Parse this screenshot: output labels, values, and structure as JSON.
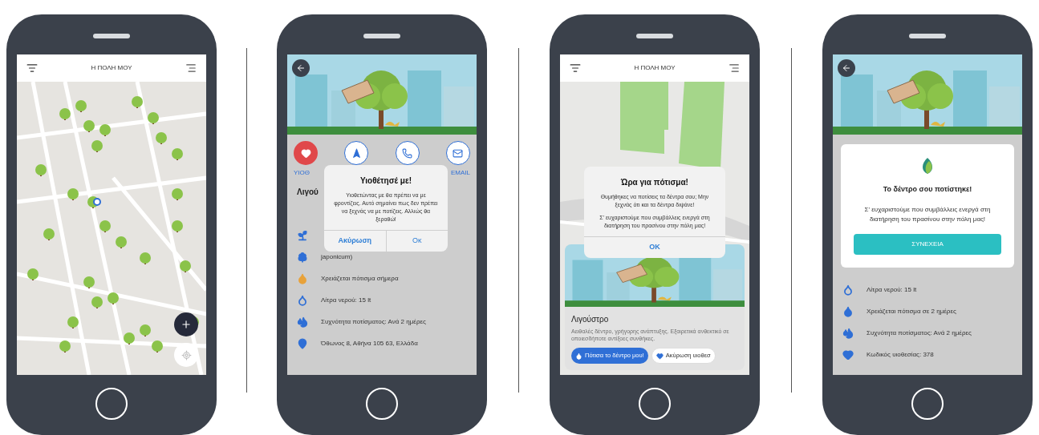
{
  "phones": [
    {
      "kind": "map",
      "header": {
        "title": "Η ΠΟΛΗ ΜΟΥ"
      }
    },
    {
      "kind": "detail",
      "actions": [
        {
          "kind": "heart",
          "label": "ΥΙΟΘ",
          "active": true
        },
        {
          "kind": "navigate",
          "active": false
        },
        {
          "kind": "phone",
          "active": false
        },
        {
          "kind": "mail",
          "label": "EMAIL",
          "active": false
        }
      ],
      "title": "Λιγού",
      "rows": [
        {
          "kind": "planter",
          "color": "#2f6fd6"
        },
        {
          "kind": "tree",
          "text": "japonicum)",
          "color": "#2f6fd6"
        },
        {
          "kind": "drop",
          "text": "Χρειάζεται πότισμα σήμερα",
          "color": "#e8a23a"
        },
        {
          "kind": "water",
          "text": "Λίτρα νερού: 15 lt",
          "color": "#2f6fd6"
        },
        {
          "kind": "frequency",
          "text": "Συχνότητα ποτίσματος: Ανά 2 ημέρες",
          "color": "#2f6fd6"
        },
        {
          "kind": "pin",
          "text": "Όθωνος 8, Αθήνα 105 63, Ελλάδα",
          "color": "#2f6fd6"
        }
      ],
      "dialog": {
        "kind": "alert",
        "title": "Υιοθέτησέ με!",
        "body": [
          "Υιοθετώντας με θα πρέπει να με φροντίζεις. Αυτό σημαίνει πως δεν πρέπει να ξεχνάς να με ποτίζεις. Αλλιώς θα ξεραθώ!"
        ],
        "buttons": [
          "Ακύρωση",
          "Οκ"
        ]
      }
    },
    {
      "kind": "map_card",
      "header": {
        "title": "Η ΠΟΛΗ ΜΟΥ"
      },
      "card": {
        "title": "Λιγούστρο",
        "description": "Αειθαλές δέντρο, γρήγορης ανάπτυξης. Εξαιρετικά ανθεκτικό σε οποιεσδήποτε αντίξοες συνθήκες.",
        "buttons": [
          {
            "label": "Πότισα το δέντρο μου!",
            "kind": "primary"
          },
          {
            "label": "Ακύρωση υιοθεσ",
            "kind": "secondary"
          }
        ]
      },
      "dialog": {
        "kind": "alert",
        "title": "Ώρα για πότισμα!",
        "body": [
          "Θυμήθηκες να ποτίσεις τα δέντρα σου; Μην ξεχνάς ότι και τα δέντρα διψάνε!",
          "Σ' ευχαριστούμε που συμβάλλεις ενεργά στη διατήρηση του πρασίνου στην πόλη μας!"
        ],
        "buttons": [
          "OK"
        ]
      }
    },
    {
      "kind": "detail",
      "rows": [
        {
          "kind": "water",
          "text": "Λίτρα νερού: 15 lt",
          "color": "#2f6fd6"
        },
        {
          "kind": "drop",
          "text": "Χρειάζεται πότισμα σε 2 ημέρες",
          "color": "#2f6fd6"
        },
        {
          "kind": "frequency",
          "text": "Συχνότητα ποτίσματος: Ανά 2 ημέρες",
          "color": "#2f6fd6"
        },
        {
          "kind": "heart",
          "text": "Κωδικός υιοθεσίας: 378",
          "color": "#2f6fd6"
        }
      ],
      "dialog": {
        "kind": "success",
        "title": "Το δέντρο σου ποτίστηκε!",
        "body": [
          "Σ' ευχαριστούμε που συμβάλλεις ενεργά στη διατήρηση του πρασίνου στην πόλη μας!"
        ],
        "buttons": [
          "ΣΥΝΕΧΕΙΑ"
        ]
      }
    }
  ]
}
